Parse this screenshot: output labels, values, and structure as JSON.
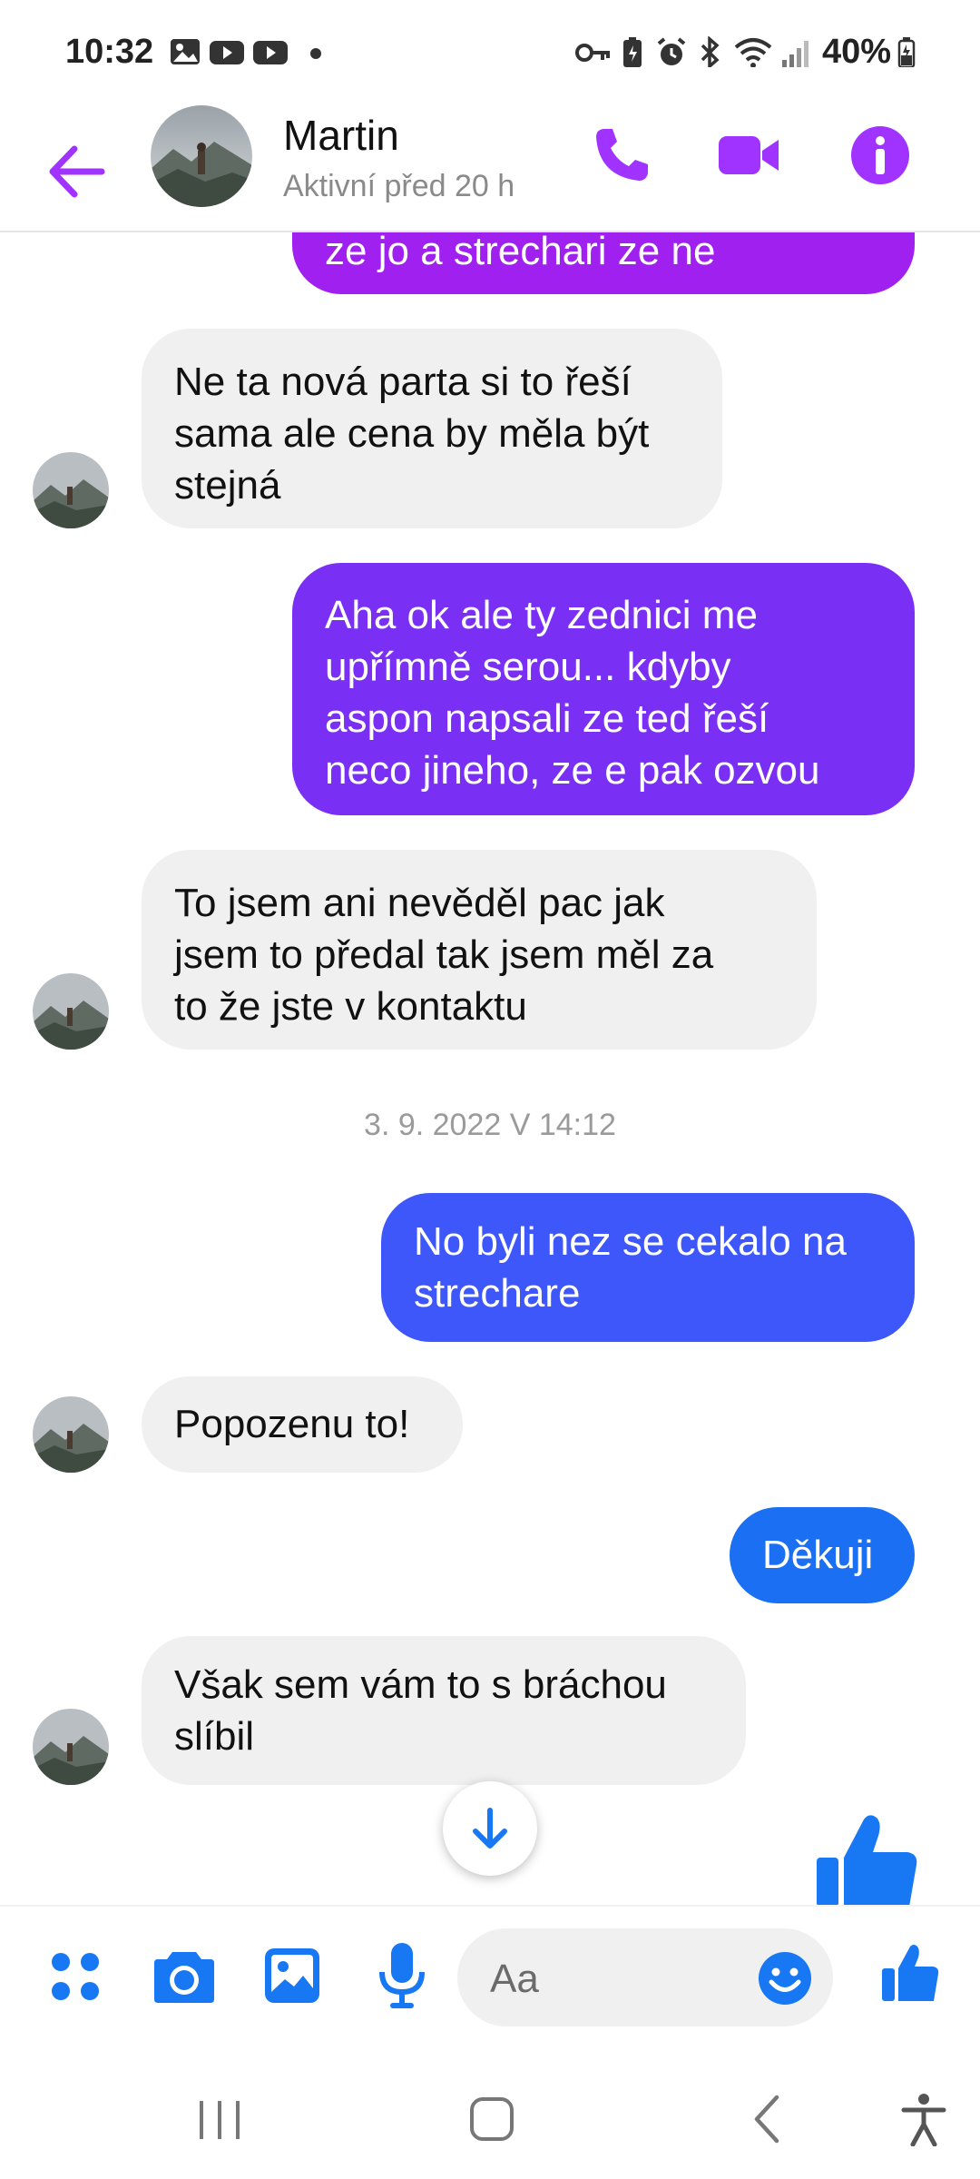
{
  "status_bar": {
    "time": "10:32",
    "battery": "40%",
    "icons": [
      "gallery-icon",
      "youtube-icon",
      "youtube-icon",
      "dot-icon",
      "vpn-key-icon",
      "battery-saver-icon",
      "alarm-icon",
      "bluetooth-icon",
      "wifi-icon",
      "signal-icon",
      "battery-icon"
    ]
  },
  "header": {
    "contact_name": "Martin",
    "contact_status": "Aktivní před 20 h",
    "accent": "#a033ff"
  },
  "messages": [
    {
      "side": "out",
      "text": "ze jo a strechari ze ne",
      "color": "#a020f0"
    },
    {
      "side": "in",
      "text": "Ne ta nová parta si to řeší\nsama ale cena by měla být\nstejná"
    },
    {
      "side": "out",
      "text": "Aha ok ale ty zednici me\nupřímně serou... kdyby\naspon napsali ze ted řeší\nneco jineho, ze e pak ozvou",
      "color": "#7a2ff5"
    },
    {
      "side": "in",
      "text": "To jsem ani nevěděl pac jak\njsem to předal tak jsem měl za\nto že jste v kontaktu"
    },
    {
      "side": "out",
      "text": "No byli nez se cekalo na\nstrechare",
      "color": "#3d57fb"
    },
    {
      "side": "in",
      "text": "Popozenu to!"
    },
    {
      "side": "out",
      "text": "Děkuji",
      "color": "#1a6ff2"
    },
    {
      "side": "in",
      "text": "Však sem vám to s bráchou\nslíbil"
    }
  ],
  "date_separator": "3. 9. 2022 V 14:12",
  "composer": {
    "placeholder": "Aa",
    "accent": "#1877f2",
    "icons": [
      "apps-icon",
      "camera-icon",
      "gallery-icon",
      "microphone-icon",
      "emoji-icon",
      "like-icon"
    ]
  },
  "nav_bar": {
    "icons": [
      "recent-apps-icon",
      "home-icon",
      "back-icon",
      "accessibility-icon"
    ]
  }
}
